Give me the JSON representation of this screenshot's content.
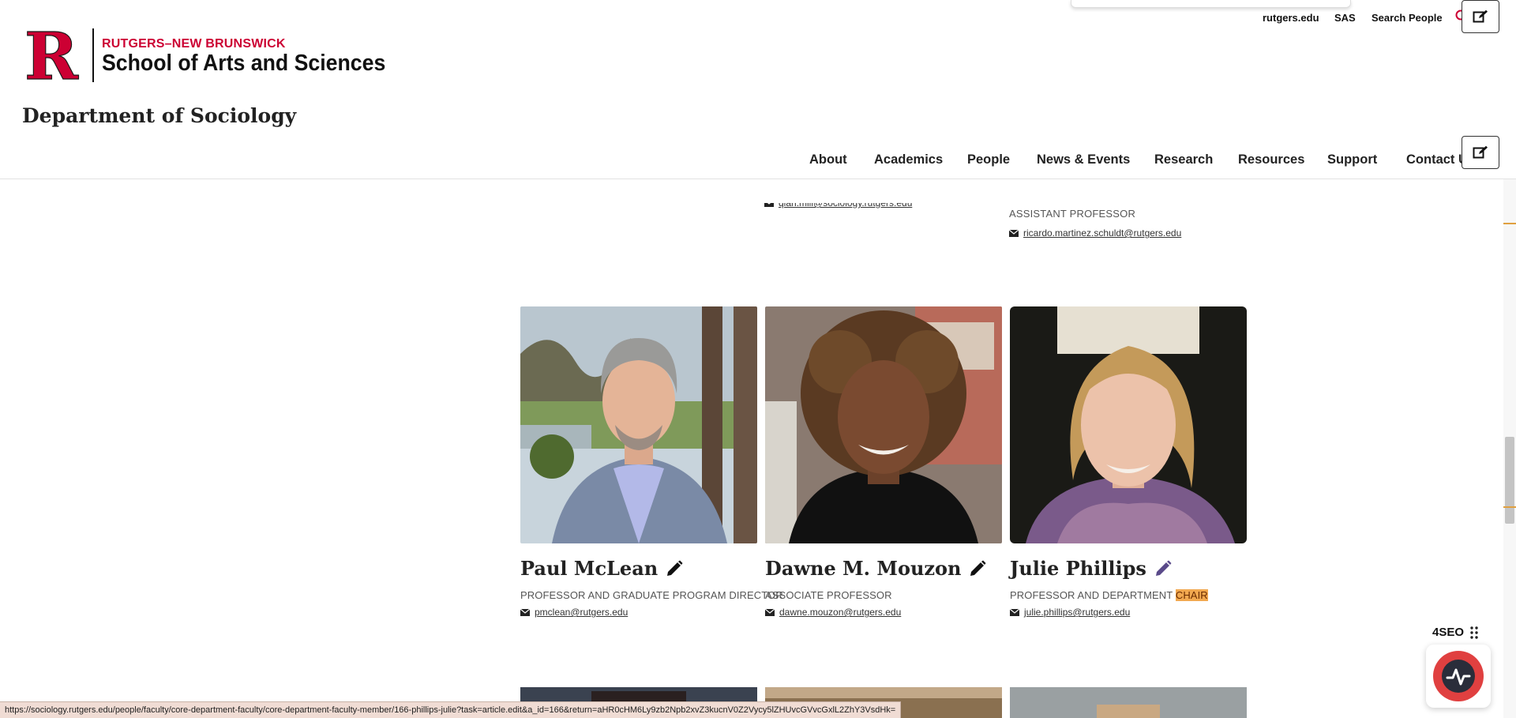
{
  "header": {
    "logo_letter": "R",
    "logo_subtitle": "RUTGERS–NEW BRUNSWICK",
    "logo_title": "School of Arts and Sciences",
    "department": "Department of Sociology",
    "brand_color": "#cc0033"
  },
  "utility_links": [
    "rutgers.edu",
    "SAS",
    "Search People"
  ],
  "nav": [
    "About",
    "Academics",
    "People",
    "News & Events",
    "Research",
    "Resources",
    "Support",
    "Contact Us"
  ],
  "previous_row": {
    "partial_email": "qian.miii@sociology.rutgers.edu",
    "title": "ASSISTANT PROFESSOR",
    "email": "ricardo.martinez.schuldt@rutgers.edu"
  },
  "faculty": [
    {
      "name": "Paul McLean",
      "title": "PROFESSOR AND GRADUATE PROGRAM DIRECTOR",
      "email": "pmclean@rutgers.edu"
    },
    {
      "name": "Dawne M. Mouzon",
      "title": "ASSOCIATE PROFESSOR",
      "email": "dawne.mouzon@rutgers.edu"
    },
    {
      "name": "Julie Phillips",
      "title_prefix": "PROFESSOR AND DEPARTMENT ",
      "title_highlight": "CHAIR",
      "email": "julie.phillips@rutgers.edu"
    }
  ],
  "widgets": {
    "seo_label": "4SEO",
    "status_url": "https://sociology.rutgers.edu/people/faculty/core-department-faculty/core-department-faculty-member/166-phillips-julie?task=article.edit&a_id=166&return=aHR0cHM6Ly9zb2Npb2xvZ3kucnV0Z2Vycy5lZHUvcGVvcGxlL2ZhY3VsdHk="
  },
  "colors": {
    "highlight": "#f2a950",
    "seo_red": "#e04040",
    "rail_marker": "#e0a040"
  }
}
